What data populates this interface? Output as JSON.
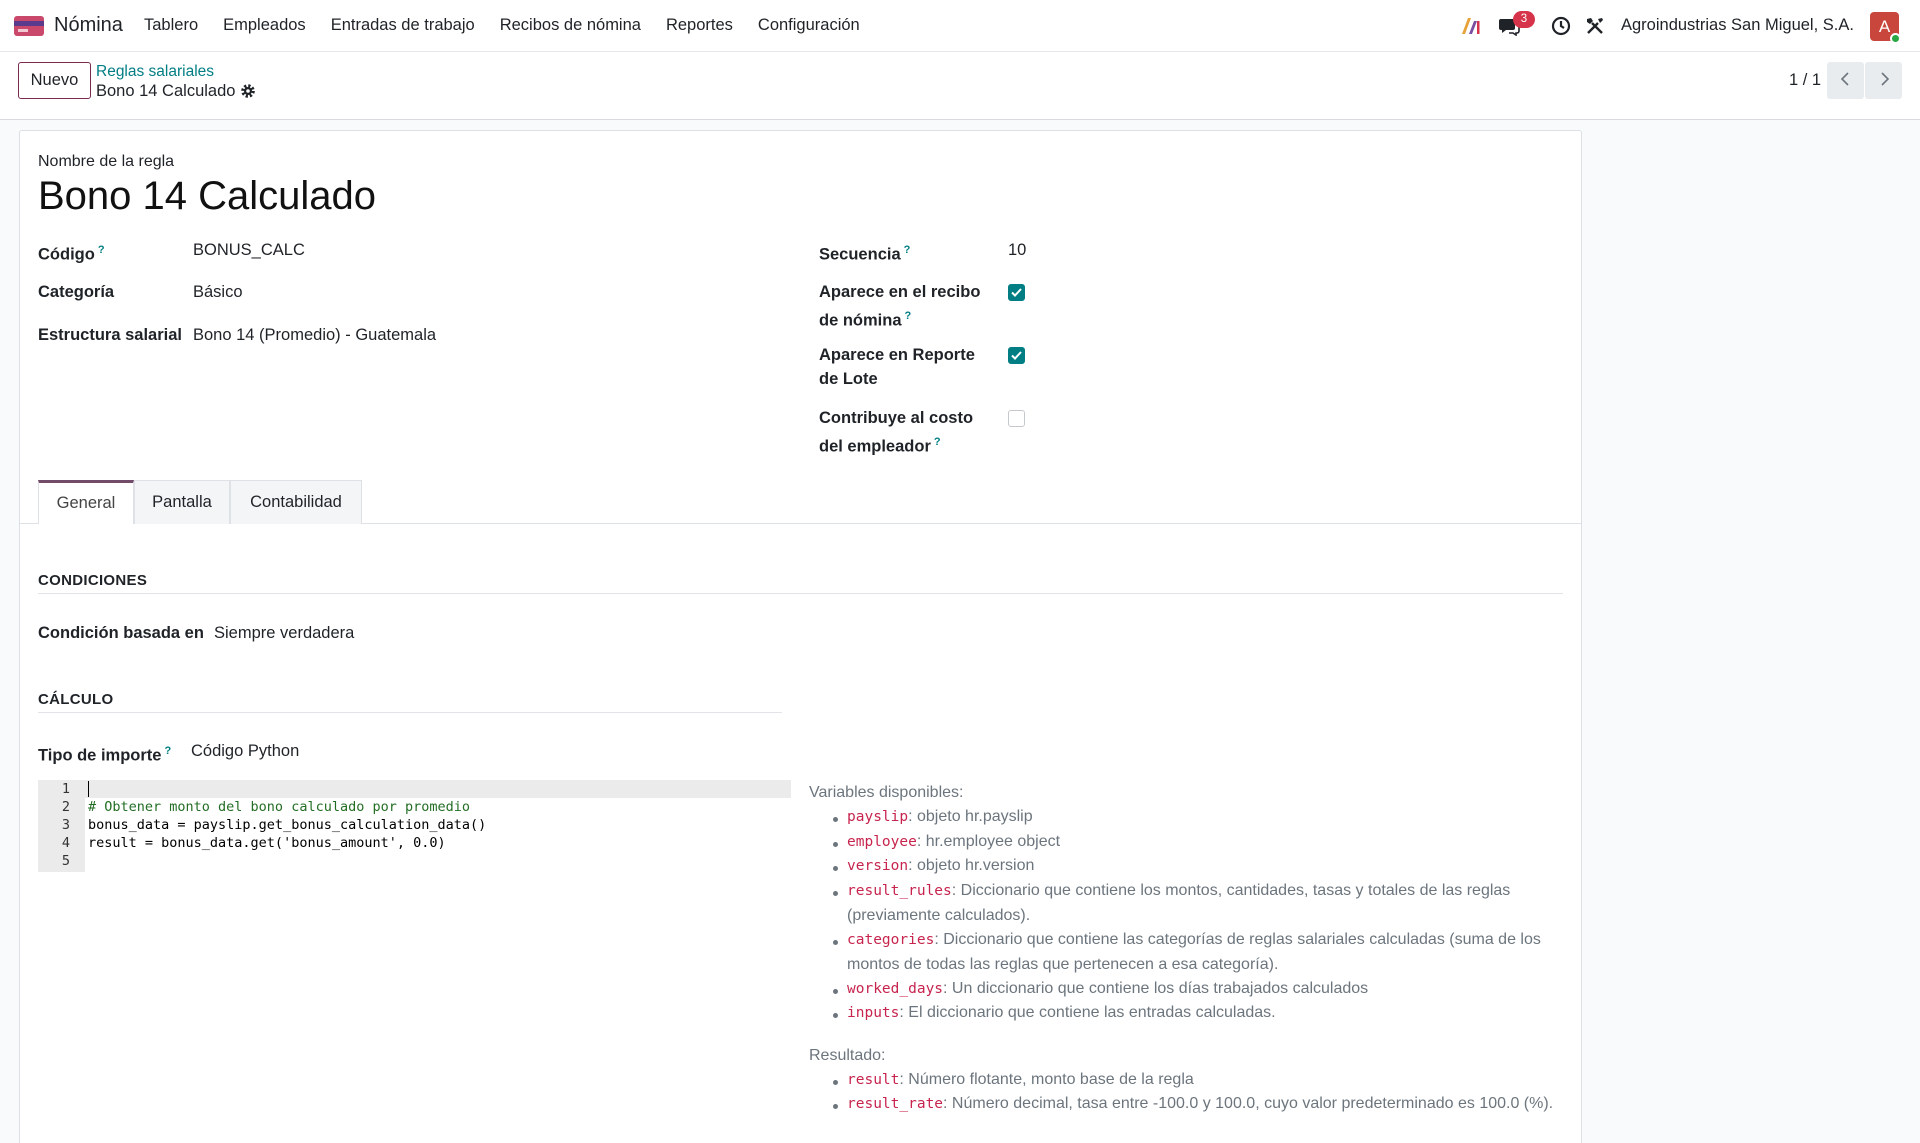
{
  "navbar": {
    "app_name": "Nómina",
    "menu": [
      "Tablero",
      "Empleados",
      "Entradas de trabajo",
      "Recibos de nómina",
      "Reportes",
      "Configuración"
    ],
    "messages_count": "3",
    "company": "Agroindustrias San Miguel, S.A.",
    "avatar_letter": "A",
    "icons": [
      "app-icon",
      "ai-icon",
      "chat-icon",
      "clock-icon",
      "tools-icon"
    ]
  },
  "control_panel": {
    "new_button": "Nuevo",
    "breadcrumb_parent": "Reglas salariales",
    "breadcrumb_current": "Bono 14 Calculado",
    "pager": "1 / 1"
  },
  "form": {
    "rule_name_label": "Nombre de la regla",
    "rule_name": "Bono 14 Calculado",
    "left_fields": {
      "code_label": "Código",
      "code_value": "BONUS_CALC",
      "category_label": "Categoría",
      "category_value": "Básico",
      "structure_label": "Estructura salarial",
      "structure_value": "Bono 14 (Promedio) - Guatemala"
    },
    "right_fields": {
      "sequence_label": "Secuencia",
      "sequence_value": "10",
      "appears_payslip_label_1": "Aparece en el recibo",
      "appears_payslip_label_2": "de nómina",
      "appears_payslip_checked": true,
      "appears_batch_label_1": "Aparece en Reporte",
      "appears_batch_label_2": "de Lote",
      "appears_batch_checked": true,
      "employer_cost_label_1": "Contribuye al costo",
      "employer_cost_label_2": "del empleador",
      "employer_cost_checked": false
    },
    "tabs": [
      "General",
      "Pantalla",
      "Contabilidad"
    ],
    "active_tab": "General",
    "conditions": {
      "title": "CONDICIONES",
      "condition_label": "Condición basada en",
      "condition_value": "Siempre verdadera"
    },
    "calculation": {
      "title": "CÁLCULO",
      "amount_type_label": "Tipo de importe",
      "amount_type_value": "Código Python",
      "code_lines": [
        "",
        "# Obtener monto del bono calculado por promedio",
        "bonus_data = payslip.get_bonus_calculation_data()",
        "result = bonus_data.get('bonus_amount', 0.0)",
        ""
      ],
      "line_numbers": [
        "1",
        "2",
        "3",
        "4",
        "5"
      ]
    },
    "help": {
      "variables_title": "Variables disponibles:",
      "variables": [
        {
          "name": "payslip",
          "desc": ": objeto hr.payslip"
        },
        {
          "name": "employee",
          "desc": ": hr.employee object"
        },
        {
          "name": "version",
          "desc": ": objeto hr.version"
        },
        {
          "name": "result_rules",
          "desc": ": Diccionario que contiene los montos, cantidades, tasas y totales de las reglas (previamente calculados)."
        },
        {
          "name": "categories",
          "desc": ": Diccionario que contiene las categorías de reglas salariales calculadas (suma de los montos de todas las reglas que pertenecen a esa categoría)."
        },
        {
          "name": "worked_days",
          "desc": ": Un diccionario que contiene los días trabajados calculados"
        },
        {
          "name": "inputs",
          "desc": ": El diccionario que contiene las entradas calculadas."
        }
      ],
      "result_title": "Resultado:",
      "results": [
        {
          "name": "result",
          "desc": ": Número flotante, monto base de la regla"
        },
        {
          "name": "result_rate",
          "desc": ": Número decimal, tasa entre -100.0 y 100.0, cuyo valor predeterminado es 100.0 (%)."
        }
      ]
    }
  },
  "colors": {
    "brand": "#714b67",
    "link": "#017e84",
    "checkbox": "#017e84",
    "badge": "#d6344a",
    "keyword": "#c7254e"
  }
}
